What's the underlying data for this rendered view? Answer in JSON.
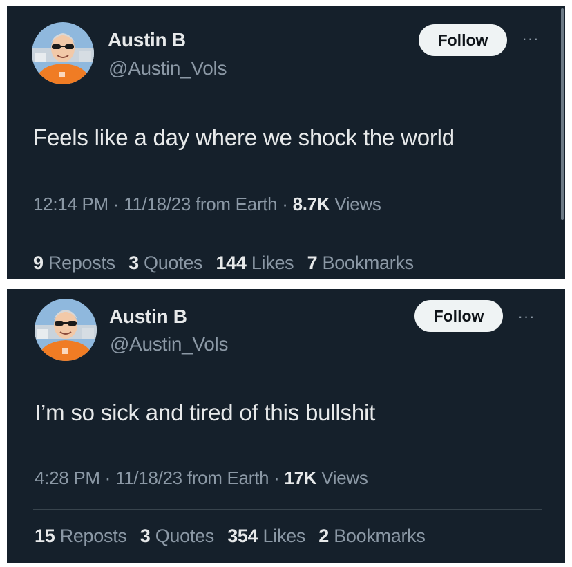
{
  "tweets": [
    {
      "author": {
        "display_name": "Austin B",
        "handle": "@Austin_Vols"
      },
      "follow_label": "Follow",
      "more_label": "···",
      "text": "Feels like a day where we shock the world",
      "time": "12:14 PM",
      "date": "11/18/23",
      "source": "from Earth",
      "views_count": "8.7K",
      "views_label": "Views",
      "stats": {
        "reposts_count": "9",
        "reposts_label": "Reposts",
        "quotes_count": "3",
        "quotes_label": "Quotes",
        "likes_count": "144",
        "likes_label": "Likes",
        "bookmarks_count": "7",
        "bookmarks_label": "Bookmarks"
      }
    },
    {
      "author": {
        "display_name": "Austin B",
        "handle": "@Austin_Vols"
      },
      "follow_label": "Follow",
      "more_label": "···",
      "text": "I’m so sick and tired of this bullshit",
      "time": "4:28 PM",
      "date": "11/18/23",
      "source": "from Earth",
      "views_count": "17K",
      "views_label": "Views",
      "stats": {
        "reposts_count": "15",
        "reposts_label": "Reposts",
        "quotes_count": "3",
        "quotes_label": "Quotes",
        "likes_count": "354",
        "likes_label": "Likes",
        "bookmarks_count": "2",
        "bookmarks_label": "Bookmarks"
      }
    }
  ],
  "colors": {
    "background": "#15202b",
    "primary_text": "#e7e9ea",
    "secondary_text": "#8b98a5",
    "follow_button_bg": "#eff3f4",
    "divider": "#38444d"
  }
}
